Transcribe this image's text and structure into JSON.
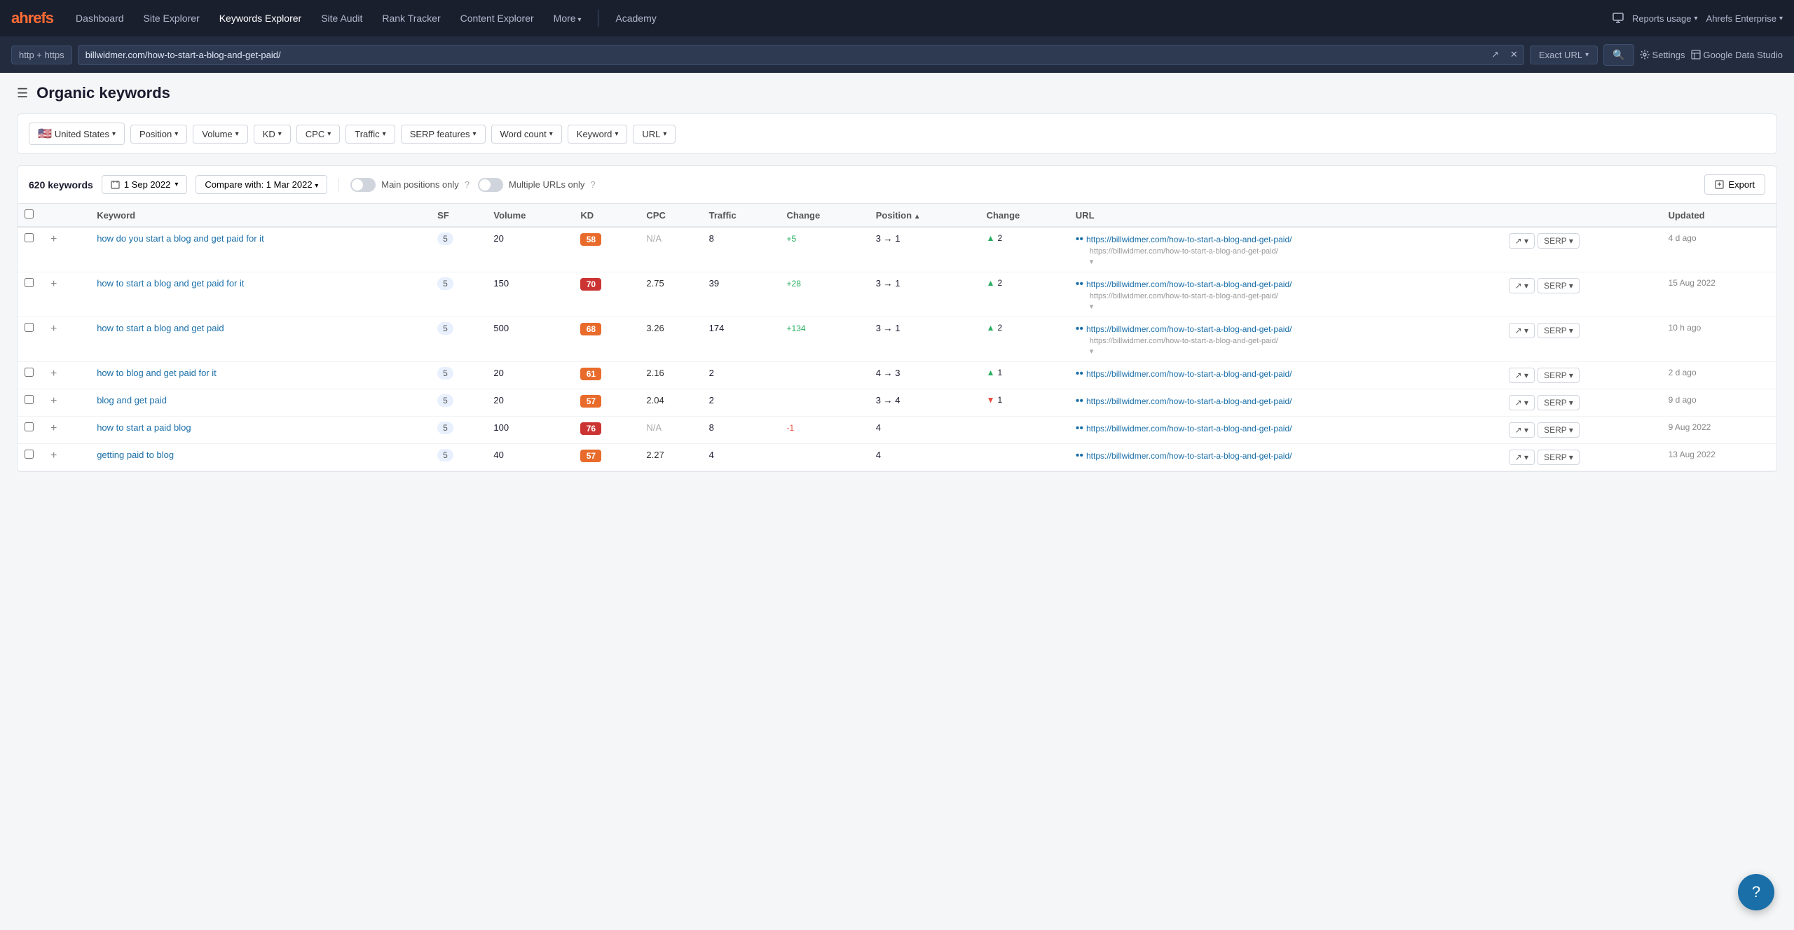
{
  "logo": "ahrefs",
  "nav": {
    "items": [
      {
        "label": "Dashboard",
        "active": false
      },
      {
        "label": "Site Explorer",
        "active": false
      },
      {
        "label": "Keywords Explorer",
        "active": false
      },
      {
        "label": "Site Audit",
        "active": false
      },
      {
        "label": "Rank Tracker",
        "active": false
      },
      {
        "label": "Content Explorer",
        "active": false
      },
      {
        "label": "More",
        "hasArrow": true,
        "active": false
      }
    ],
    "academy": "Academy",
    "reports_usage": "Reports usage",
    "enterprise": "Ahrefs Enterprise",
    "gds": "Google Data Studio"
  },
  "urlbar": {
    "protocol": "http + https",
    "url": "billwidmer.com/how-to-start-a-blog-and-get-paid/",
    "mode": "Exact URL",
    "settings": "Settings"
  },
  "page": {
    "title": "Organic keywords"
  },
  "filters": [
    {
      "label": "United States",
      "hasFlag": true,
      "flagEmoji": "🇺🇸"
    },
    {
      "label": "Position"
    },
    {
      "label": "Volume"
    },
    {
      "label": "KD"
    },
    {
      "label": "CPC"
    },
    {
      "label": "Traffic"
    },
    {
      "label": "SERP features"
    },
    {
      "label": "Word count"
    },
    {
      "label": "Keyword"
    },
    {
      "label": "URL"
    }
  ],
  "toolbar": {
    "keyword_count": "620 keywords",
    "date": "1 Sep 2022",
    "compare_label": "Compare with: 1 Mar 2022",
    "main_positions_label": "Main positions only",
    "multiple_urls_label": "Multiple URLs only",
    "export_label": "Export"
  },
  "table": {
    "columns": [
      "",
      "",
      "Keyword",
      "SF",
      "Volume",
      "KD",
      "CPC",
      "Traffic",
      "Change",
      "Position",
      "Change",
      "URL",
      "",
      "Updated"
    ],
    "rows": [
      {
        "keyword": "how do you start a blog and get paid for it",
        "sf": "5",
        "volume": "20",
        "kd": "58",
        "kd_class": "kd-orange",
        "cpc": "N/A",
        "traffic": "8",
        "traffic_change": "+5",
        "traffic_change_class": "change-pos",
        "position_from": "3",
        "position_to": "1",
        "position_change": "2",
        "position_change_dir": "up",
        "url": "https://billwidmer.com/how-to-start-a-blog-and-get-paid/",
        "url_sub": "https://billwidmer.com/how-to-start-a-blog-and-get-paid/",
        "updated": "4 d ago"
      },
      {
        "keyword": "how to start a blog and get paid for it",
        "sf": "5",
        "volume": "150",
        "kd": "70",
        "kd_class": "kd-red",
        "cpc": "2.75",
        "traffic": "39",
        "traffic_change": "+28",
        "traffic_change_class": "change-pos",
        "position_from": "3",
        "position_to": "1",
        "position_change": "2",
        "position_change_dir": "up",
        "url": "https://billwidmer.com/how-to-start-a-blog-and-get-paid/",
        "url_sub": "https://billwidmer.com/how-to-start-a-blog-and-get-paid/",
        "updated": "15 Aug 2022"
      },
      {
        "keyword": "how to start a blog and get paid",
        "sf": "5",
        "volume": "500",
        "kd": "68",
        "kd_class": "kd-orange",
        "cpc": "3.26",
        "traffic": "174",
        "traffic_change": "+134",
        "traffic_change_class": "change-pos",
        "position_from": "3",
        "position_to": "1",
        "position_change": "2",
        "position_change_dir": "up",
        "url": "https://billwidmer.com/how-to-start-a-blog-and-get-paid/",
        "url_sub": "https://billwidmer.com/how-to-start-a-blog-and-get-paid/",
        "updated": "10 h ago"
      },
      {
        "keyword": "how to blog and get paid for it",
        "sf": "5",
        "volume": "20",
        "kd": "61",
        "kd_class": "kd-orange",
        "cpc": "2.16",
        "traffic": "2",
        "traffic_change": "",
        "traffic_change_class": "change-neutral",
        "position_from": "4",
        "position_to": "3",
        "position_change": "1",
        "position_change_dir": "up",
        "url": "https://billwidmer.com/how-to-start-a-blog-and-get-paid/",
        "url_sub": "",
        "updated": "2 d ago"
      },
      {
        "keyword": "blog and get paid",
        "sf": "5",
        "volume": "20",
        "kd": "57",
        "kd_class": "kd-orange",
        "cpc": "2.04",
        "traffic": "2",
        "traffic_change": "",
        "traffic_change_class": "change-neutral",
        "position_from": "3",
        "position_to": "4",
        "position_change": "1",
        "position_change_dir": "down",
        "url": "https://billwidmer.com/how-to-start-a-blog-and-get-paid/",
        "url_sub": "",
        "updated": "9 d ago"
      },
      {
        "keyword": "how to start a paid blog",
        "sf": "5",
        "volume": "100",
        "kd": "76",
        "kd_class": "kd-red",
        "cpc": "N/A",
        "traffic": "8",
        "traffic_change": "-1",
        "traffic_change_class": "change-neg",
        "position_from": "",
        "position_to": "4",
        "position_change": "",
        "position_change_dir": "none",
        "url": "https://billwidmer.com/how-to-start-a-blog-and-get-paid/",
        "url_sub": "",
        "updated": "9 Aug 2022"
      },
      {
        "keyword": "getting paid to blog",
        "sf": "5",
        "volume": "40",
        "kd": "57",
        "kd_class": "kd-orange",
        "cpc": "2.27",
        "traffic": "4",
        "traffic_change": "",
        "traffic_change_class": "change-neutral",
        "position_from": "",
        "position_to": "4",
        "position_change": "",
        "position_change_dir": "none",
        "url": "https://billwidmer.com/how-to-start-a-blog-and-get-paid/",
        "url_sub": "",
        "updated": "13 Aug 2022"
      }
    ]
  }
}
